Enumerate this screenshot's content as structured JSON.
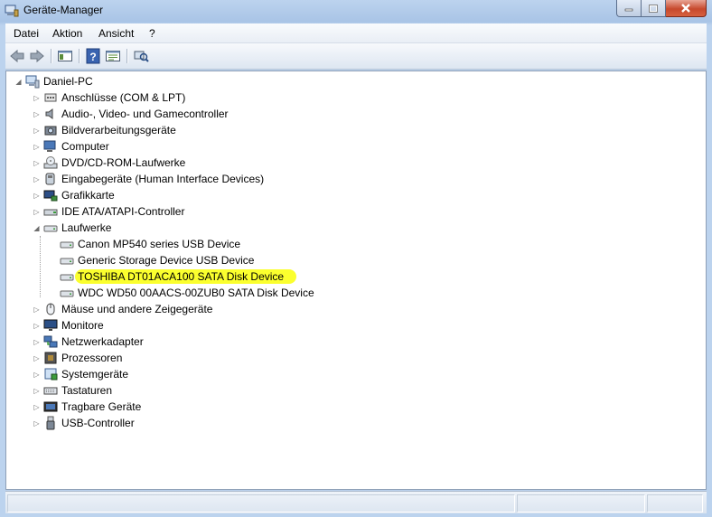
{
  "window": {
    "title": "Geräte-Manager"
  },
  "menu": [
    "Datei",
    "Aktion",
    "Ansicht",
    "?"
  ],
  "toolbar": {
    "icons": [
      "back-arrow-icon",
      "forward-arrow-icon",
      "show-hide-console-tree-icon",
      "help-icon",
      "properties-icon",
      "scan-hardware-icon"
    ]
  },
  "tree": {
    "root": "Daniel-PC",
    "categories": [
      {
        "label": "Anschlüsse (COM & LPT)",
        "icon": "port-icon"
      },
      {
        "label": "Audio-, Video- und Gamecontroller",
        "icon": "speaker-icon"
      },
      {
        "label": "Bildverarbeitungsgeräte",
        "icon": "imaging-device-icon"
      },
      {
        "label": "Computer",
        "icon": "computer-icon"
      },
      {
        "label": "DVD/CD-ROM-Laufwerke",
        "icon": "dvd-drive-icon"
      },
      {
        "label": "Eingabegeräte (Human Interface Devices)",
        "icon": "hid-icon"
      },
      {
        "label": "Grafikkarte",
        "icon": "display-adapter-icon"
      },
      {
        "label": "IDE ATA/ATAPI-Controller",
        "icon": "ide-controller-icon"
      },
      {
        "label": "Laufwerke",
        "icon": "disk-drive-icon",
        "expanded": true,
        "children": [
          "Canon MP540 series USB Device",
          "Generic Storage Device USB Device",
          "TOSHIBA DT01ACA100 SATA Disk Device",
          "WDC WD50 00AACS-00ZUB0 SATA Disk Device"
        ],
        "highlighted_child": 2
      },
      {
        "label": "Mäuse und andere Zeigegeräte",
        "icon": "mouse-icon"
      },
      {
        "label": "Monitore",
        "icon": "monitor-icon"
      },
      {
        "label": "Netzwerkadapter",
        "icon": "network-adapter-icon"
      },
      {
        "label": "Prozessoren",
        "icon": "processor-icon"
      },
      {
        "label": "Systemgeräte",
        "icon": "system-device-icon"
      },
      {
        "label": "Tastaturen",
        "icon": "keyboard-icon"
      },
      {
        "label": "Tragbare Geräte",
        "icon": "portable-device-icon"
      },
      {
        "label": "USB-Controller",
        "icon": "usb-icon"
      }
    ]
  },
  "colors": {
    "highlight": "#fbff2e",
    "title_bar": "#a9c4e6"
  }
}
